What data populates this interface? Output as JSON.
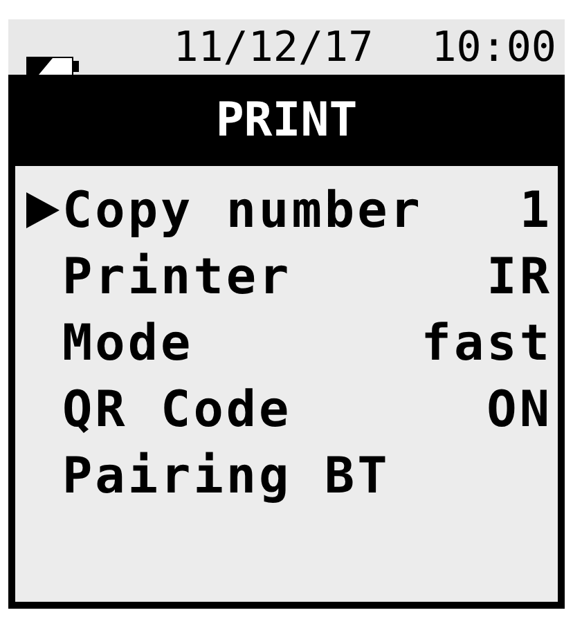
{
  "status_bar": {
    "date": "11/12/17",
    "time": "10:00"
  },
  "title": "PRINT",
  "menu": [
    {
      "label": "Copy number",
      "value": "1",
      "selected": true
    },
    {
      "label": "Printer",
      "value": "IR",
      "selected": false
    },
    {
      "label": "Mode",
      "value": "fast",
      "selected": false
    },
    {
      "label": "QR Code",
      "value": "ON",
      "selected": false
    },
    {
      "label": "Pairing BT",
      "selected": false
    }
  ]
}
